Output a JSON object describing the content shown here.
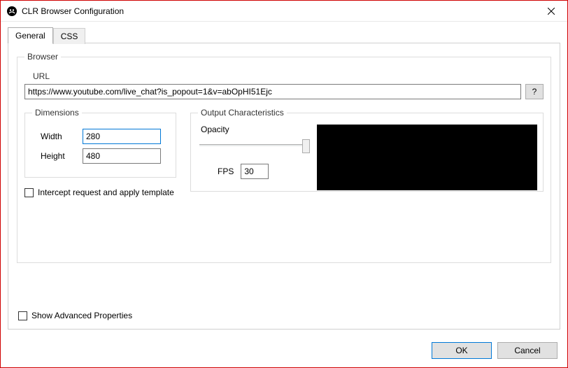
{
  "window": {
    "title": "CLR Browser Configuration"
  },
  "tabs": {
    "general": "General",
    "css": "CSS"
  },
  "browser": {
    "legend": "Browser",
    "url_label": "URL",
    "url_value": "https://www.youtube.com/live_chat?is_popout=1&v=abOpHI51Ejc",
    "help_label": "?",
    "intercept_label": "Intercept request and apply template"
  },
  "dimensions": {
    "legend": "Dimensions",
    "width_label": "Width",
    "width_value": "280",
    "height_label": "Height",
    "height_value": "480"
  },
  "output": {
    "legend": "Output Characteristics",
    "opacity_label": "Opacity",
    "fps_label": "FPS",
    "fps_value": "30"
  },
  "advanced": {
    "label": "Show Advanced Properties"
  },
  "buttons": {
    "ok": "OK",
    "cancel": "Cancel"
  }
}
